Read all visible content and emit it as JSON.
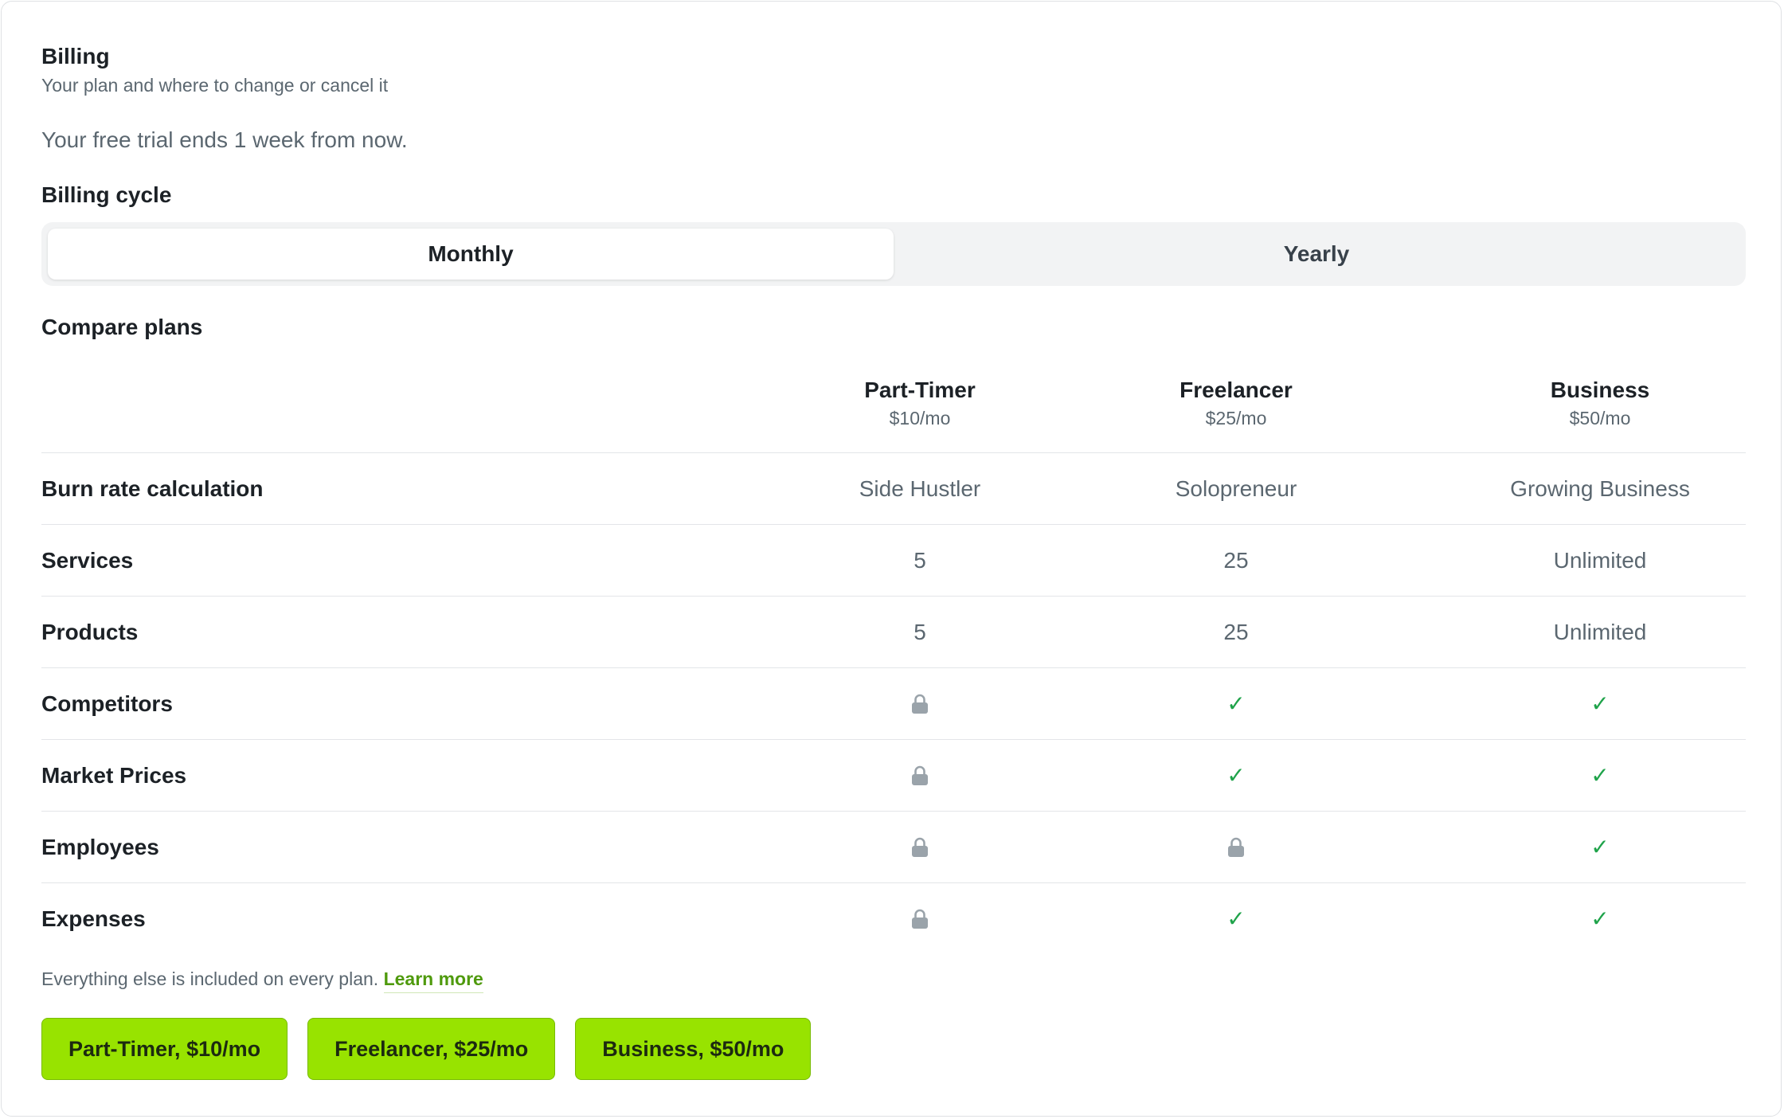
{
  "billing": {
    "title": "Billing",
    "subtitle": "Your plan and where to change or cancel it",
    "trial_text": "Your free trial ends 1 week from now."
  },
  "billing_cycle": {
    "label": "Billing cycle",
    "options": [
      "Monthly",
      "Yearly"
    ],
    "selected": "Monthly"
  },
  "compare": {
    "label": "Compare plans",
    "plans": [
      {
        "name": "Part-Timer",
        "price": "$10/mo"
      },
      {
        "name": "Freelancer",
        "price": "$25/mo"
      },
      {
        "name": "Business",
        "price": "$50/mo"
      }
    ],
    "rows": [
      {
        "label": "Burn rate calculation",
        "values": [
          "Side Hustler",
          "Solopreneur",
          "Growing Business"
        ]
      },
      {
        "label": "Services",
        "values": [
          "5",
          "25",
          "Unlimited"
        ]
      },
      {
        "label": "Products",
        "values": [
          "5",
          "25",
          "Unlimited"
        ]
      },
      {
        "label": "Competitors",
        "values": [
          "lock-icon",
          "check-icon",
          "check-icon"
        ]
      },
      {
        "label": "Market Prices",
        "values": [
          "lock-icon",
          "check-icon",
          "check-icon"
        ]
      },
      {
        "label": "Employees",
        "values": [
          "lock-icon",
          "lock-icon",
          "check-icon"
        ]
      },
      {
        "label": "Expenses",
        "values": [
          "lock-icon",
          "check-icon",
          "check-icon"
        ]
      }
    ]
  },
  "footnote": {
    "text": "Everything else is included on every plan.",
    "link": "Learn more"
  },
  "buttons": [
    "Part-Timer, $10/mo",
    "Freelancer, $25/mo",
    "Business, $50/mo"
  ],
  "colors": {
    "accent": "#98e300",
    "check": "#1fa34a",
    "lock": "#9aa3aa",
    "link": "#4f9a0d"
  }
}
